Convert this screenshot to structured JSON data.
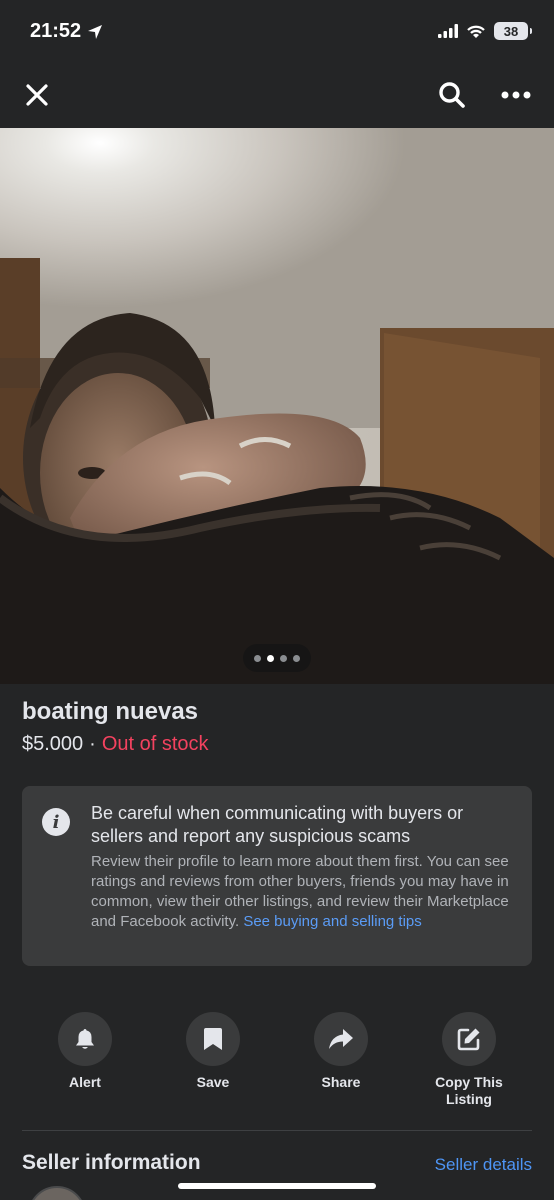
{
  "status_bar": {
    "time": "21:52",
    "battery": "38"
  },
  "nav": {
    "close_icon": "close-icon",
    "search_icon": "search-icon",
    "more_icon": "more-icon"
  },
  "photo": {
    "image_count": 4,
    "active_index": 1
  },
  "listing": {
    "title": "boating nuevas",
    "price": "$5.000",
    "separator": "·",
    "stock_status": "Out of stock",
    "stock_color": "#f3425f"
  },
  "warning": {
    "icon": "info-icon",
    "heading": "Be careful when communicating with buyers or sellers and report any suspicious scams",
    "body": "Review their profile to learn more about them first. You can see ratings and reviews from other buyers, friends you may have in common, view their other listings, and review their Marketplace and Facebook activity.",
    "link": "See buying and selling tips"
  },
  "actions": [
    {
      "label": "Alert",
      "icon": "bell-icon"
    },
    {
      "label": "Save",
      "icon": "bookmark-icon"
    },
    {
      "label": "Share",
      "icon": "share-icon"
    },
    {
      "label": "Copy This Listing",
      "icon": "edit-icon"
    }
  ],
  "seller": {
    "title": "Seller information",
    "details_link": "Seller details"
  },
  "colors": {
    "background": "#242526",
    "card": "#3a3b3c",
    "link": "#4e95f5"
  }
}
